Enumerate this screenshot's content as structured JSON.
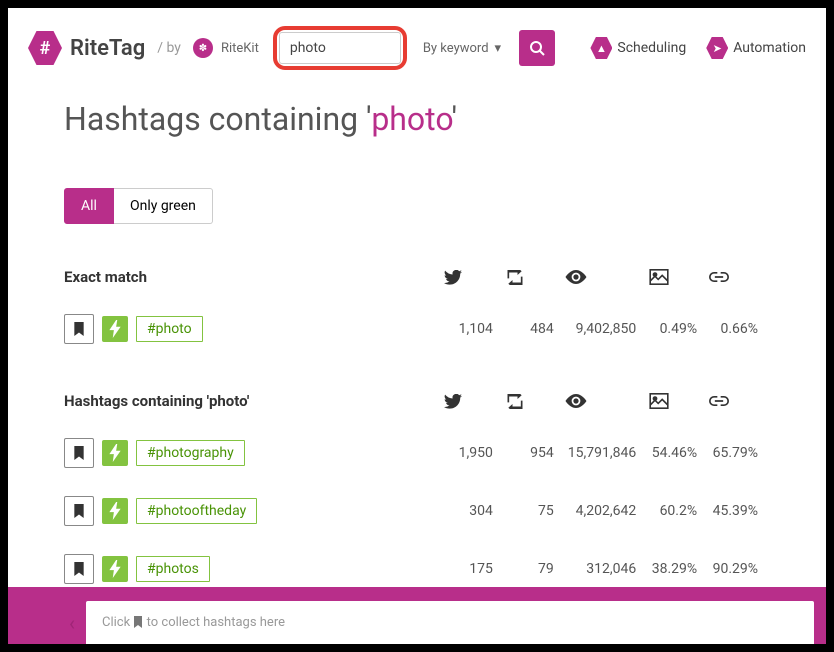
{
  "header": {
    "brand": "RiteTag",
    "by": "by",
    "kit": "RiteKit",
    "search_value": "photo",
    "dropdown": "By keyword",
    "nav": [
      {
        "label": "Scheduling"
      },
      {
        "label": "Automation"
      }
    ]
  },
  "title": {
    "prefix": "Hashtags containing '",
    "term": "photo",
    "suffix": "'"
  },
  "filters": {
    "all": "All",
    "green": "Only green"
  },
  "sections": [
    {
      "title": "Exact match",
      "rows": [
        {
          "tag": "#photo",
          "tweets": "1,104",
          "retweets": "484",
          "views": "9,402,850",
          "img": "0.49%",
          "link": "0.66%"
        }
      ]
    },
    {
      "title": "Hashtags containing 'photo'",
      "rows": [
        {
          "tag": "#photography",
          "tweets": "1,950",
          "retweets": "954",
          "views": "15,791,846",
          "img": "54.46%",
          "link": "65.79%"
        },
        {
          "tag": "#photooftheday",
          "tweets": "304",
          "retweets": "75",
          "views": "4,202,642",
          "img": "60.2%",
          "link": "45.39%"
        },
        {
          "tag": "#photos",
          "tweets": "175",
          "retweets": "79",
          "views": "312,046",
          "img": "38.29%",
          "link": "90.29%"
        }
      ]
    }
  ],
  "footer": {
    "prefix": "Click ",
    "suffix": " to collect hashtags here"
  }
}
